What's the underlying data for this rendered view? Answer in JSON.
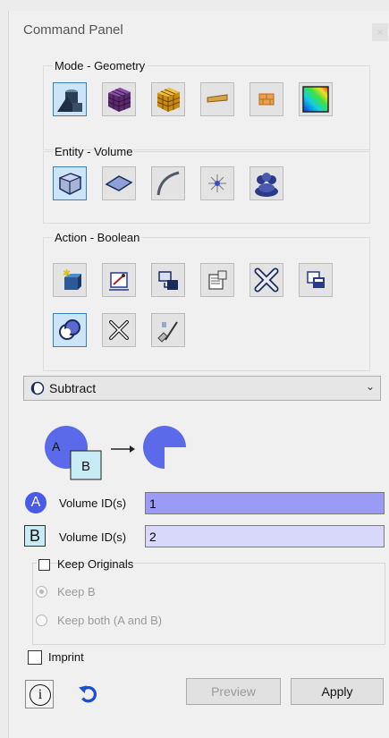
{
  "window": {
    "title": "Command Panel",
    "close_glyph": "×"
  },
  "mode": {
    "legend": "Mode - Geometry",
    "buttons": [
      {
        "icon": "geometry-solids-icon",
        "selected": true
      },
      {
        "icon": "mesh-cube-purple-icon",
        "selected": false
      },
      {
        "icon": "mesh-cube-orange-icon",
        "selected": false
      },
      {
        "icon": "bar-element-icon",
        "selected": false
      },
      {
        "icon": "brick-wall-icon",
        "selected": false
      },
      {
        "icon": "color-gradient-icon",
        "selected": false
      }
    ]
  },
  "entity": {
    "legend": "Entity - Volume",
    "buttons": [
      {
        "icon": "volume-cube-icon",
        "selected": true
      },
      {
        "icon": "surface-icon",
        "selected": false
      },
      {
        "icon": "curve-icon",
        "selected": false
      },
      {
        "icon": "vertex-icon",
        "selected": false
      },
      {
        "icon": "group-icon",
        "selected": false
      }
    ]
  },
  "action": {
    "legend": "Action - Boolean",
    "buttons": [
      {
        "icon": "create-icon",
        "selected": false
      },
      {
        "icon": "modify-icon",
        "selected": false
      },
      {
        "icon": "transform-icon",
        "selected": false
      },
      {
        "icon": "properties-icon",
        "selected": false
      },
      {
        "icon": "delete-icon",
        "selected": false
      },
      {
        "icon": "copy-icon",
        "selected": false
      },
      {
        "icon": "boolean-icon",
        "selected": true
      },
      {
        "icon": "decompose-icon",
        "selected": false
      },
      {
        "icon": "cleanup-icon",
        "selected": false
      }
    ]
  },
  "operation": {
    "selected": "Subtract",
    "icon": "subtract-icon"
  },
  "diagram": {
    "a_label": "A",
    "b_label": "B"
  },
  "volume_a": {
    "badge": "A",
    "label": "Volume ID(s)",
    "value": "1",
    "color": "#9b9bf5"
  },
  "volume_b": {
    "badge": "B",
    "label": "Volume ID(s)",
    "value": "2",
    "color": "#d8d8fb"
  },
  "keep": {
    "legend": "Keep Originals",
    "checked": false,
    "option_b": "Keep B",
    "option_both": "Keep both (A and B)"
  },
  "imprint": {
    "label": "Imprint",
    "checked": false
  },
  "footer": {
    "info_glyph": "i",
    "preview": "Preview",
    "apply": "Apply"
  },
  "colors": {
    "accent": "#4a5ae8",
    "selected_bg": "#cce4f7",
    "selected_border": "#3c7fb1"
  }
}
